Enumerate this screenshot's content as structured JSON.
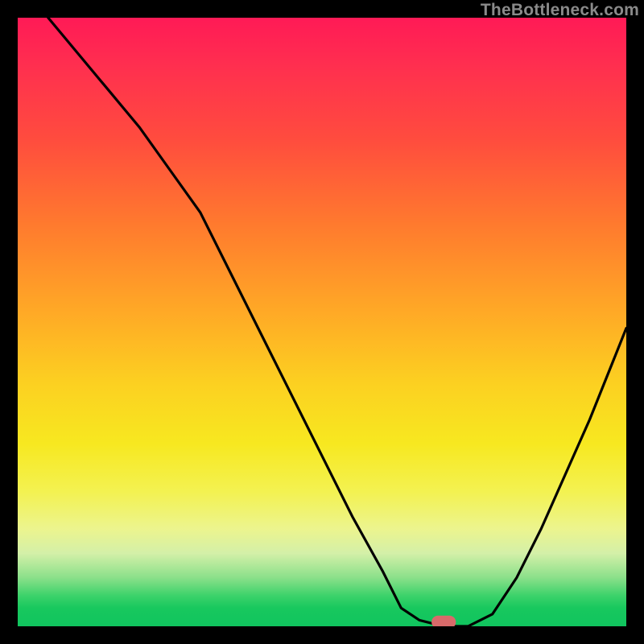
{
  "watermark": "TheBottleneck.com",
  "chart_data": {
    "type": "line",
    "title": "",
    "xlabel": "",
    "ylabel": "",
    "xlim": [
      0,
      100
    ],
    "ylim": [
      0,
      100
    ],
    "grid": false,
    "legend": false,
    "series": [
      {
        "name": "bottleneck-curve",
        "x": [
          5,
          10,
          15,
          20,
          25,
          30,
          35,
          40,
          45,
          50,
          55,
          60,
          63,
          66,
          70,
          74,
          78,
          82,
          86,
          90,
          94,
          98,
          100
        ],
        "y": [
          100,
          94,
          88,
          82,
          75,
          68,
          58,
          48,
          38,
          28,
          18,
          9,
          3,
          1,
          0,
          0,
          2,
          8,
          16,
          25,
          34,
          44,
          49
        ]
      }
    ],
    "marker": {
      "name": "optimal-marker",
      "x_range": [
        68,
        72
      ],
      "y": 0.7,
      "color": "#d86a6a"
    },
    "colors": {
      "curve_stroke": "#000000",
      "background_top": "#ff1a56",
      "background_bottom": "#10c45e",
      "frame": "#000000",
      "marker": "#d86a6a"
    }
  }
}
